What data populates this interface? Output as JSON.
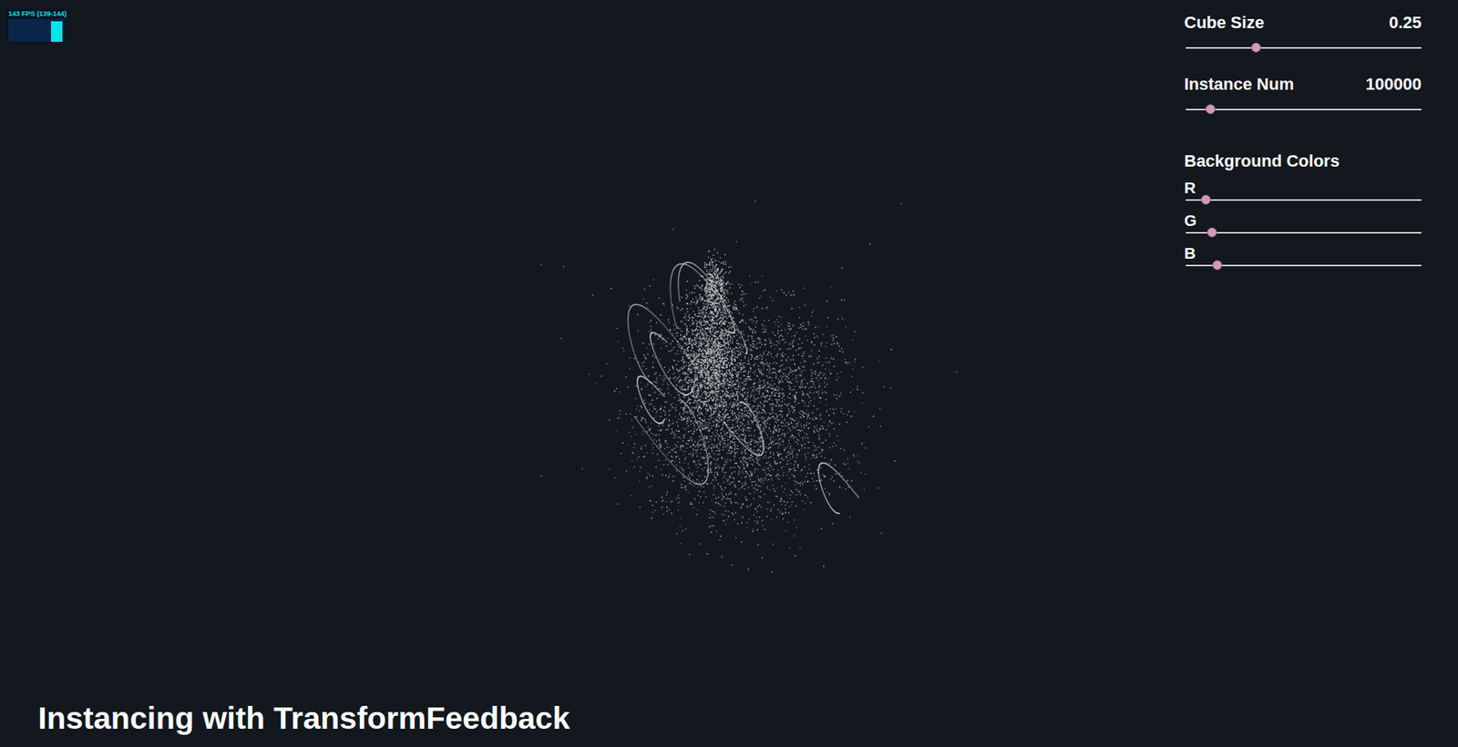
{
  "fps_meter": {
    "text": "143 FPS (139-144)",
    "level": 0.9
  },
  "controls": [
    {
      "kind": "slider",
      "label": "Cube Size",
      "value": "0.25",
      "level": 0.3
    },
    {
      "kind": "slider",
      "label": "Instance Num",
      "value": "100000",
      "level": 0.11
    },
    {
      "kind": "heading",
      "label": "Background Colors"
    },
    {
      "kind": "channel",
      "label": "R",
      "level": 0.09
    },
    {
      "kind": "channel",
      "label": "G",
      "level": 0.114
    },
    {
      "kind": "channel",
      "label": "B",
      "level": 0.138
    }
  ],
  "title": "Instancing with TransformFeedback"
}
